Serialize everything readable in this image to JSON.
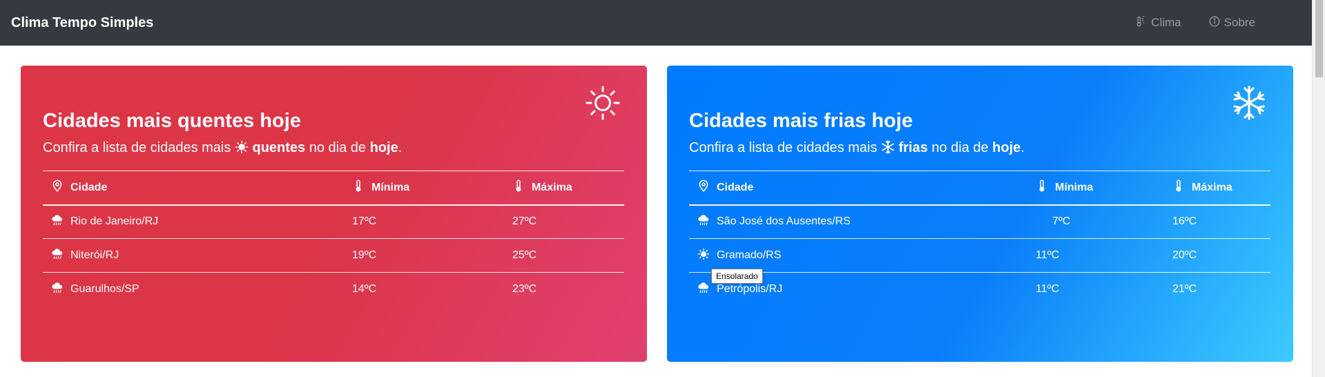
{
  "navbar": {
    "brand": "Clima Tempo Simples",
    "links": [
      {
        "label": "Clima",
        "icon": "thermometer-sun-icon"
      },
      {
        "label": "Sobre",
        "icon": "info-circle-icon"
      }
    ]
  },
  "hot": {
    "icon": "sun-icon",
    "title": "Cidades mais quentes hoje",
    "sub_prefix": "Confira a lista de cidades mais",
    "sub_keyword": "quentes",
    "sub_middle": "no dia de",
    "sub_day": "hoje",
    "sub_end": ".",
    "headers": {
      "city": "Cidade",
      "min": "Mínima",
      "max": "Máxima"
    },
    "rows": [
      {
        "icon": "rain-cloud-icon",
        "city": "Rio de Janeiro/RJ",
        "min": "17ºC",
        "max": "27ºC"
      },
      {
        "icon": "rain-cloud-icon",
        "city": "Niterói/RJ",
        "min": "19ºC",
        "max": "25ºC"
      },
      {
        "icon": "rain-cloud-icon",
        "city": "Guarulhos/SP",
        "min": "14ºC",
        "max": "23ºC"
      }
    ]
  },
  "cold": {
    "icon": "snowflake-icon",
    "title": "Cidades mais frias hoje",
    "sub_prefix": "Confira a lista de cidades mais",
    "sub_keyword": "frias",
    "sub_middle": "no dia de",
    "sub_day": "hoje",
    "sub_end": ".",
    "headers": {
      "city": "Cidade",
      "min": "Mínima",
      "max": "Máxima"
    },
    "rows": [
      {
        "icon": "rain-cloud-icon",
        "city": "São José dos Ausentes/RS",
        "min": "7ºC",
        "max": "16ºC"
      },
      {
        "icon": "sun-icon",
        "city": "Gramado/RS",
        "min": "11ºC",
        "max": "20ºC"
      },
      {
        "icon": "rain-cloud-icon",
        "city": "Petrópolis/RJ",
        "min": "11ºC",
        "max": "21ºC"
      }
    ]
  },
  "tooltip": "Ensolarado",
  "colors": {
    "navbar": "#343a40",
    "hot": "#dc3545",
    "cold": "#007bff"
  }
}
